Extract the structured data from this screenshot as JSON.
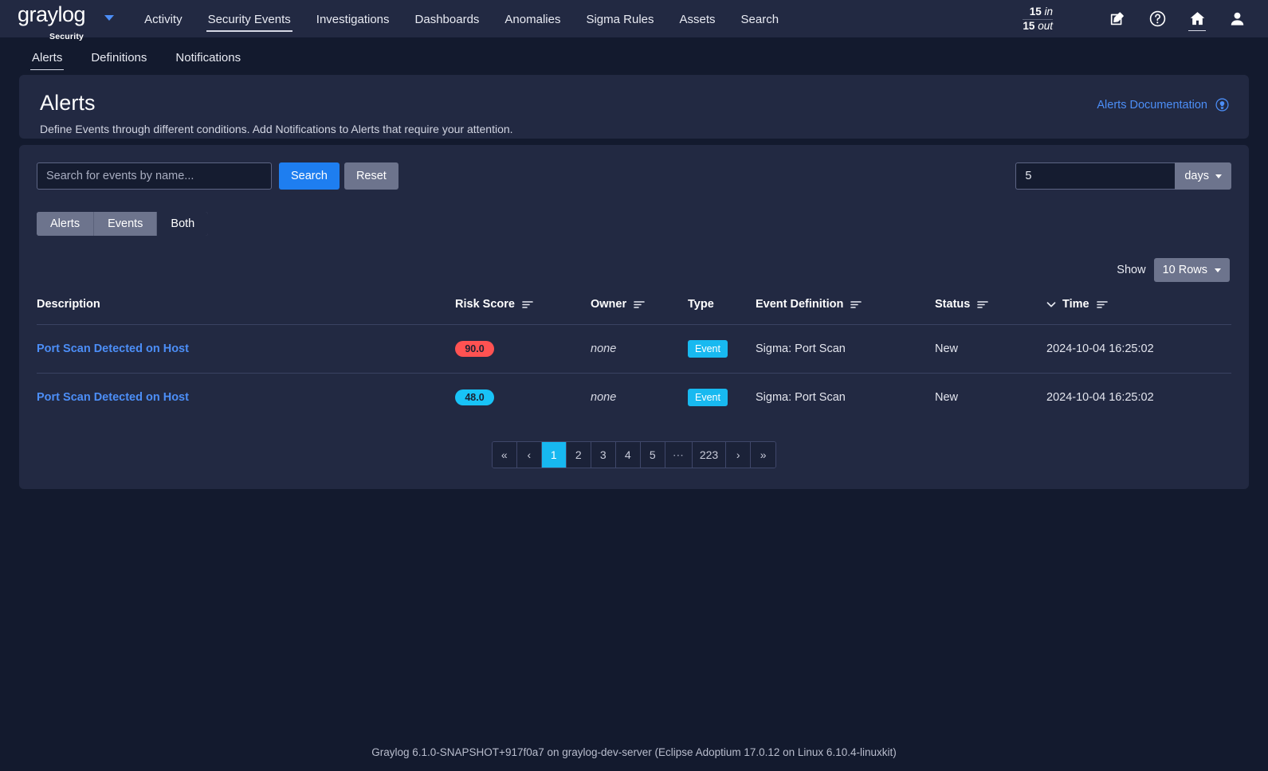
{
  "brand": {
    "name": "graylog",
    "product": "Security"
  },
  "nav": {
    "links": [
      {
        "label": "Activity",
        "active": false
      },
      {
        "label": "Security Events",
        "active": true
      },
      {
        "label": "Investigations",
        "active": false
      },
      {
        "label": "Dashboards",
        "active": false
      },
      {
        "label": "Anomalies",
        "active": false
      },
      {
        "label": "Sigma Rules",
        "active": false
      },
      {
        "label": "Assets",
        "active": false
      },
      {
        "label": "Search",
        "active": false
      }
    ],
    "throughput": {
      "in_value": "15",
      "in_label": "in",
      "out_value": "15",
      "out_label": "out"
    },
    "icons": [
      {
        "name": "edit-icon",
        "title": "Edit"
      },
      {
        "name": "help-icon",
        "title": "Help"
      },
      {
        "name": "home-icon",
        "title": "Home"
      },
      {
        "name": "user-avatar-icon",
        "title": "User"
      }
    ]
  },
  "subtabs": [
    {
      "label": "Alerts",
      "active": true
    },
    {
      "label": "Definitions",
      "active": false
    },
    {
      "label": "Notifications",
      "active": false
    }
  ],
  "header": {
    "title": "Alerts",
    "description": "Define Events through different conditions. Add Notifications to Alerts that require your attention.",
    "doc_link": "Alerts Documentation"
  },
  "filters": {
    "search_placeholder": "Search for events by name...",
    "search_value": "",
    "search_button": "Search",
    "reset_button": "Reset",
    "timerange_value": "5",
    "timerange_unit": "days",
    "segments": [
      {
        "label": "Alerts",
        "active": false
      },
      {
        "label": "Events",
        "active": false
      },
      {
        "label": "Both",
        "active": true
      }
    ]
  },
  "table_controls": {
    "show_label": "Show",
    "rows_value": "10 Rows"
  },
  "table": {
    "columns": [
      {
        "label": "Description",
        "sortable": false,
        "sorted": false
      },
      {
        "label": "Risk Score",
        "sortable": true,
        "sorted": false
      },
      {
        "label": "Owner",
        "sortable": true,
        "sorted": false
      },
      {
        "label": "Type",
        "sortable": false,
        "sorted": false
      },
      {
        "label": "Event Definition",
        "sortable": true,
        "sorted": false
      },
      {
        "label": "Status",
        "sortable": true,
        "sorted": false
      },
      {
        "label": "Time",
        "sortable": true,
        "sorted": true,
        "sort_direction": "desc"
      }
    ],
    "rows": [
      {
        "description": "Port Scan Detected on Host",
        "risk_score": "90.0",
        "risk_color": "#ff5252",
        "owner": "none",
        "type": "Event",
        "event_definition": "Sigma: Port Scan",
        "status": "New",
        "time": "2024-10-04 16:25:02"
      },
      {
        "description": "Port Scan Detected on Host",
        "risk_score": "48.0",
        "risk_color": "#18c3f7",
        "owner": "none",
        "type": "Event",
        "event_definition": "Sigma: Port Scan",
        "status": "New",
        "time": "2024-10-04 16:25:02"
      }
    ]
  },
  "pagination": {
    "items": [
      {
        "label": "«",
        "name": "first-page",
        "active": false
      },
      {
        "label": "‹",
        "name": "previous-page",
        "active": false
      },
      {
        "label": "1",
        "name": "page-1",
        "active": true
      },
      {
        "label": "2",
        "name": "page-2",
        "active": false
      },
      {
        "label": "3",
        "name": "page-3",
        "active": false
      },
      {
        "label": "4",
        "name": "page-4",
        "active": false
      },
      {
        "label": "5",
        "name": "page-5",
        "active": false
      },
      {
        "label": "⋯",
        "name": "page-ellipsis",
        "active": false
      },
      {
        "label": "223",
        "name": "page-223",
        "active": false
      },
      {
        "label": "›",
        "name": "next-page",
        "active": false
      },
      {
        "label": "»",
        "name": "last-page",
        "active": false
      }
    ]
  },
  "footer": {
    "text": "Graylog 6.1.0-SNAPSHOT+917f0a7 on graylog-dev-server (Eclipse Adoptium 17.0.12 on Linux 6.10.4-linuxkit)"
  },
  "colors": {
    "page_bg": "#131a2e",
    "card_bg": "#222942",
    "accent_blue": "#4c8ef7",
    "accent_cyan": "#17b8f0",
    "primary_button": "#1e7ef0"
  }
}
